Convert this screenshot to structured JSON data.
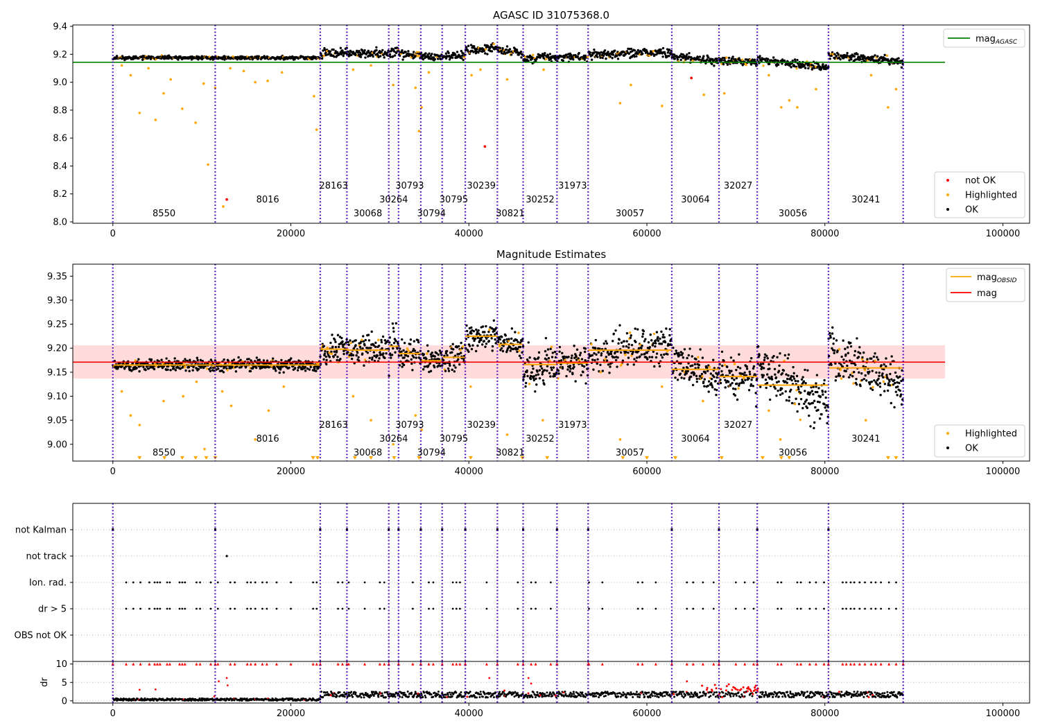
{
  "chart_data": [
    {
      "type": "scatter",
      "title": "AGASC ID 31075368.0",
      "xlim": [
        -4500,
        103000
      ],
      "ylim": [
        7.99,
        9.41
      ],
      "x_ticks": [
        0,
        20000,
        40000,
        60000,
        80000,
        100000
      ],
      "x_tick_labels": [
        "0",
        "20000",
        "40000",
        "60000",
        "80000",
        "100000"
      ],
      "y_ticks": [
        8.0,
        8.2,
        8.4,
        8.6,
        8.8,
        9.0,
        9.2,
        9.4
      ],
      "y_tick_labels": [
        "8.0",
        "8.2",
        "8.4",
        "8.6",
        "8.8",
        "9.0",
        "9.2",
        "9.4"
      ],
      "hline": {
        "name": "mag_AGASC",
        "y": 9.143,
        "x_range": [
          -4500,
          93500
        ],
        "color": "#008000"
      },
      "series_colors": {
        "not OK": "#ff0000",
        "Highlighted": "#ffa500",
        "OK": "#000000"
      },
      "outliers_highlighted": [
        [
          1000,
          9.12
        ],
        [
          2000,
          9.05
        ],
        [
          3000,
          8.78
        ],
        [
          4000,
          9.1
        ],
        [
          4800,
          8.73
        ],
        [
          5700,
          8.92
        ],
        [
          6500,
          9.02
        ],
        [
          7800,
          8.81
        ],
        [
          9300,
          8.71
        ],
        [
          10200,
          8.99
        ],
        [
          10700,
          8.41
        ],
        [
          11500,
          8.96
        ],
        [
          12400,
          8.11
        ],
        [
          13200,
          9.1
        ],
        [
          14700,
          9.08
        ],
        [
          16000,
          9.0
        ],
        [
          17400,
          9.01
        ],
        [
          19000,
          9.07
        ],
        [
          22600,
          8.9
        ],
        [
          22900,
          8.66
        ],
        [
          27000,
          9.09
        ],
        [
          29000,
          9.12
        ],
        [
          31500,
          8.98
        ],
        [
          34000,
          8.96
        ],
        [
          34400,
          8.65
        ],
        [
          34700,
          8.82
        ],
        [
          35500,
          9.07
        ],
        [
          40300,
          9.05
        ],
        [
          41300,
          9.09
        ],
        [
          44300,
          9.02
        ],
        [
          48400,
          9.09
        ],
        [
          57000,
          8.85
        ],
        [
          58200,
          8.98
        ],
        [
          61700,
          8.83
        ],
        [
          66400,
          8.91
        ],
        [
          68700,
          8.92
        ],
        [
          73700,
          9.05
        ],
        [
          75100,
          8.82
        ],
        [
          76000,
          8.87
        ],
        [
          76900,
          8.82
        ],
        [
          79000,
          8.95
        ],
        [
          85200,
          9.05
        ],
        [
          87100,
          8.82
        ],
        [
          88000,
          8.95
        ]
      ],
      "outliers_not_ok": [
        [
          12800,
          8.16
        ],
        [
          41800,
          8.54
        ],
        [
          65000,
          9.03
        ]
      ],
      "legend_upper": [
        "mag_AGASC"
      ],
      "legend_lower": [
        "not OK",
        "Highlighted",
        "OK"
      ],
      "legend_placement": [
        "upper right",
        "lower right"
      ]
    },
    {
      "type": "scatter",
      "title": "Magnitude Estimates",
      "xlim": [
        -4500,
        103000
      ],
      "ylim": [
        8.965,
        9.375
      ],
      "x_ticks": [
        0,
        20000,
        40000,
        60000,
        80000,
        100000
      ],
      "x_tick_labels": [
        "0",
        "20000",
        "40000",
        "60000",
        "80000",
        "100000"
      ],
      "y_ticks": [
        9.0,
        9.05,
        9.1,
        9.15,
        9.2,
        9.25,
        9.3,
        9.35
      ],
      "y_tick_labels": [
        "9.00",
        "9.05",
        "9.10",
        "9.15",
        "9.20",
        "9.25",
        "9.30",
        "9.35"
      ],
      "mag_line": {
        "name": "mag",
        "y": 9.171,
        "x_range": [
          -4500,
          93500
        ],
        "color": "#ff0000"
      },
      "mag_band": [
        9.137,
        9.206
      ],
      "obsid_means": [
        9.165,
        9.165,
        9.198,
        9.196,
        9.204,
        9.189,
        9.174,
        9.181,
        9.225,
        9.208,
        9.166,
        9.169,
        9.196,
        9.156,
        9.141,
        9.123,
        9.159
      ],
      "series_colors": {
        "Highlighted": "#ffa500",
        "OK": "#000000",
        "mag_OBSID": "#ffa500"
      },
      "highlighted_outliers": [
        [
          1000,
          9.11
        ],
        [
          2000,
          9.06
        ],
        [
          3000,
          9.04
        ],
        [
          5700,
          9.09
        ],
        [
          7900,
          9.1
        ],
        [
          9400,
          9.13
        ],
        [
          10300,
          8.99
        ],
        [
          12300,
          9.11
        ],
        [
          13300,
          9.08
        ],
        [
          16000,
          9.01
        ],
        [
          17500,
          9.07
        ],
        [
          19200,
          9.12
        ],
        [
          27000,
          9.1
        ],
        [
          29000,
          9.05
        ],
        [
          31500,
          9.0
        ],
        [
          34000,
          9.06
        ],
        [
          34700,
          9.03
        ],
        [
          40200,
          9.12
        ],
        [
          44300,
          9.02
        ],
        [
          48300,
          9.05
        ],
        [
          57000,
          9.01
        ],
        [
          61700,
          9.12
        ],
        [
          66300,
          9.09
        ],
        [
          73700,
          9.07
        ],
        [
          75000,
          9.01
        ],
        [
          84600,
          9.05
        ]
      ],
      "below_axis_markers_x": [
        3000,
        5800,
        7800,
        9300,
        10500,
        11500,
        22500,
        23000,
        27200,
        29000,
        31600,
        34400,
        40200,
        46000,
        48800,
        57300,
        60000,
        63200,
        68400,
        73000,
        75100,
        76000,
        87100,
        88000
      ],
      "legend_upper": [
        "mag_OBSID",
        "mag"
      ],
      "legend_lower": [
        "Highlighted",
        "OK"
      ],
      "legend_placement": [
        "upper right",
        "lower right"
      ]
    },
    {
      "type": "scatter",
      "title": "",
      "xlim": [
        -4500,
        103000
      ],
      "y_categories": [
        "not Kalman",
        "not track",
        "Ion. rad.",
        "dr > 5",
        "OBS not OK"
      ],
      "flags_at_boundaries": "not Kalman",
      "not_track_x": [
        12800
      ],
      "ion_rad_x": [
        1500,
        2300,
        3100,
        4100,
        4700,
        5000,
        5300,
        6100,
        6400,
        7500,
        7800,
        8100,
        9400,
        9800,
        11000,
        11800,
        13200,
        13700,
        15100,
        15500,
        16000,
        16800,
        17300,
        18400,
        20000,
        22500,
        22900,
        25300,
        25800,
        26500,
        28300,
        30000,
        30500,
        33700,
        35500,
        36000,
        38200,
        38600,
        39000,
        42000,
        45500,
        47000,
        47500,
        49200,
        53500,
        55000,
        59000,
        59500,
        61000,
        64500,
        65200,
        66300,
        67500,
        70000,
        71000,
        72000,
        74700,
        75100,
        76900,
        77300,
        78300,
        79000,
        79900,
        82000,
        82400,
        82900,
        83300,
        83900,
        84500,
        85200,
        85700,
        86300,
        87200,
        88000
      ],
      "dr5_x": [
        1500,
        2300,
        3100,
        4100,
        4700,
        5000,
        5300,
        6100,
        6400,
        7500,
        7800,
        8100,
        9400,
        9800,
        11000,
        11800,
        13200,
        13700,
        15100,
        15500,
        16000,
        16800,
        17300,
        18400,
        20000,
        22500,
        22900,
        25300,
        25800,
        26500,
        28300,
        30000,
        30500,
        33700,
        35500,
        36000,
        38200,
        38600,
        39000,
        42000,
        45500,
        47000,
        47500,
        49200,
        53500,
        55000,
        59000,
        59500,
        61000,
        64500,
        65200,
        66300,
        67500,
        70000,
        71000,
        72000,
        74700,
        75100,
        76900,
        77300,
        78300,
        79000,
        79900,
        82000,
        82400,
        82900,
        83300,
        83900,
        84500,
        85200,
        85700,
        86300,
        87200,
        88000
      ]
    },
    {
      "type": "scatter",
      "title": "",
      "ylabel": "dr",
      "xlim": [
        -4500,
        103000
      ],
      "ylim": [
        -0.6,
        10.7
      ],
      "x_ticks": [
        0,
        20000,
        40000,
        60000,
        80000,
        100000
      ],
      "x_tick_labels": [
        "0",
        "20000",
        "40000",
        "60000",
        "80000",
        "100000"
      ],
      "y_ticks": [
        0,
        5,
        10
      ],
      "y_tick_labels": [
        "0",
        "5",
        "10"
      ],
      "clipped_value": 10,
      "outliers": [
        [
          12800,
          6.2
        ],
        [
          12900,
          4.2
        ],
        [
          11900,
          5.3
        ],
        [
          11400,
          1.2
        ],
        [
          3000,
          3.0
        ],
        [
          4800,
          3.1
        ],
        [
          46700,
          6.2
        ],
        [
          47000,
          4.7
        ],
        [
          42300,
          6.2
        ],
        [
          64500,
          5.3
        ],
        [
          48000,
          1.5
        ],
        [
          44000,
          2.8
        ]
      ],
      "series_colors": {
        "not OK": "#ff0000",
        "OK": "#000000"
      }
    }
  ],
  "obsid_segments": [
    {
      "obsid": "8550",
      "start": 0,
      "end": 11500,
      "level": 0,
      "agasc_mean": 9.165
    },
    {
      "obsid": "8016",
      "start": 11500,
      "end": 23300,
      "level": 1,
      "agasc_mean": 9.165
    },
    {
      "obsid": "28163",
      "start": 23300,
      "end": 26300,
      "level": 2,
      "agasc_mean": 9.198
    },
    {
      "obsid": "30068",
      "start": 26300,
      "end": 31000,
      "level": 0,
      "agasc_mean": 9.196
    },
    {
      "obsid": "30264",
      "start": 31000,
      "end": 32100,
      "level": 1,
      "agasc_mean": 9.204
    },
    {
      "obsid": "30793",
      "start": 32100,
      "end": 34600,
      "level": 2,
      "agasc_mean": 9.189
    },
    {
      "obsid": "30794",
      "start": 34600,
      "end": 37000,
      "level": 0,
      "agasc_mean": 9.174
    },
    {
      "obsid": "30795",
      "start": 37000,
      "end": 39600,
      "level": 1,
      "agasc_mean": 9.181
    },
    {
      "obsid": "30239",
      "start": 39600,
      "end": 43200,
      "level": 2,
      "agasc_mean": 9.225
    },
    {
      "obsid": "30821",
      "start": 43200,
      "end": 46100,
      "level": 0,
      "agasc_mean": 9.208
    },
    {
      "obsid": "30252",
      "start": 46100,
      "end": 49900,
      "level": 1,
      "agasc_mean": 9.166
    },
    {
      "obsid": "31973",
      "start": 49900,
      "end": 53400,
      "level": 2,
      "agasc_mean": 9.169
    },
    {
      "obsid": "30057",
      "start": 53400,
      "end": 62800,
      "level": 0,
      "agasc_mean": 9.196
    },
    {
      "obsid": "30064",
      "start": 62800,
      "end": 68100,
      "level": 1,
      "agasc_mean": 9.156
    },
    {
      "obsid": "32027",
      "start": 68100,
      "end": 72400,
      "level": 2,
      "agasc_mean": 9.141
    },
    {
      "obsid": "30056",
      "start": 72400,
      "end": 80400,
      "level": 0,
      "agasc_mean": 9.123
    },
    {
      "obsid": "30241",
      "start": 80400,
      "end": 88800,
      "level": 1,
      "agasc_mean": 9.159
    }
  ],
  "legend_labels": {
    "mag_agasc": "mag",
    "mag_agasc_sub": "AGASC",
    "mag_obsid": "mag",
    "mag_obsid_sub": "OBSID",
    "mag": "mag",
    "not_ok": "not OK",
    "highlighted": "Highlighted",
    "ok": "OK"
  },
  "colors": {
    "boundary_outer": "#0000ff",
    "boundary_inner": "#800080",
    "agasc_line": "#008000",
    "mag_line": "#ff0000",
    "mag_band": "#ffcccc",
    "highlighted": "#ffa500",
    "ok": "#000000",
    "not_ok": "#ff0000",
    "grid": "#b0b0b0"
  }
}
